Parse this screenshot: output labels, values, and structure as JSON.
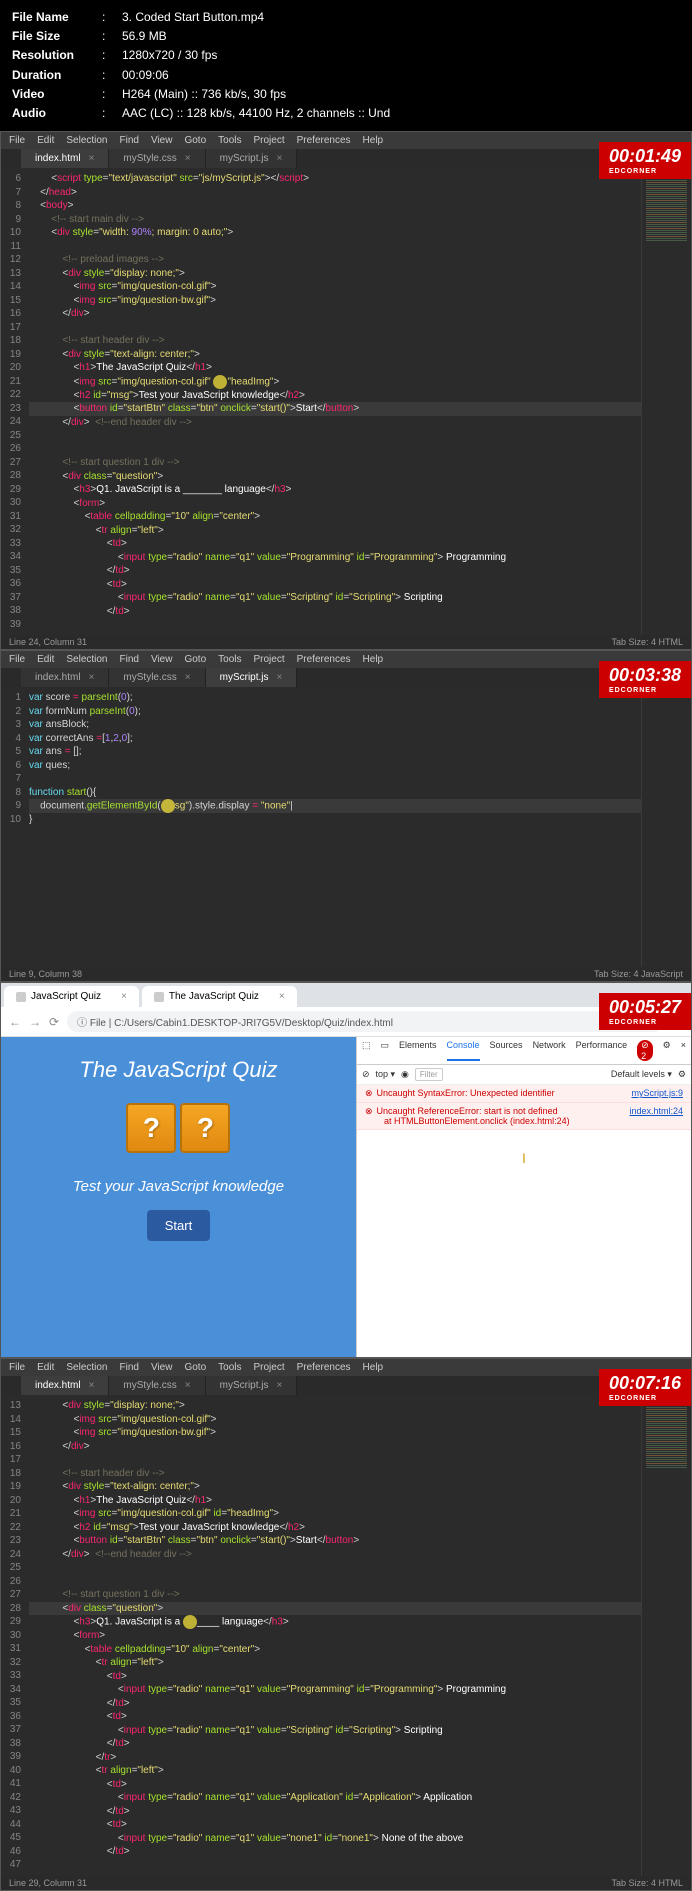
{
  "meta": {
    "fileName": "3. Coded Start Button.mp4",
    "fileSize": "56.9 MB",
    "resolution": "1280x720 / 30 fps",
    "duration": "00:09:06",
    "video": "H264 (Main) :: 736 kb/s, 30 fps",
    "audio": "AAC (LC) :: 128 kb/s, 44100 Hz, 2 channels :: Und"
  },
  "menus": [
    "File",
    "Edit",
    "Selection",
    "Find",
    "View",
    "Goto",
    "Tools",
    "Project",
    "Preferences",
    "Help"
  ],
  "brand": "EDCORNER",
  "panel1": {
    "timestamp": "00:01:49",
    "tabs": [
      {
        "label": "index.html",
        "active": true
      },
      {
        "label": "myStyle.css",
        "active": false
      },
      {
        "label": "myScript.js",
        "active": false
      }
    ],
    "statusLeft": "Line 24, Column 31",
    "statusRight": "Tab Size: 4        HTML"
  },
  "panel2": {
    "timestamp": "00:03:38",
    "tabs": [
      {
        "label": "index.html",
        "active": false
      },
      {
        "label": "myStyle.css",
        "active": false
      },
      {
        "label": "myScript.js",
        "active": true
      }
    ],
    "statusLeft": "Line 9, Column 38",
    "statusRight": "Tab Size: 4        JavaScript"
  },
  "panel3": {
    "timestamp": "00:05:27",
    "browserTabs": [
      {
        "label": "JavaScript Quiz"
      },
      {
        "label": "The JavaScript Quiz"
      }
    ],
    "url": "File | C:/Users/Cabin1.DESKTOP-JRI7G5V/Desktop/Quiz/index.html",
    "quizTitle": "The JavaScript Quiz",
    "quizSubtitle": "Test your JavaScript knowledge",
    "startLabel": "Start",
    "devTabs": [
      "Elements",
      "Console",
      "Sources",
      "Network",
      "Performance"
    ],
    "filterPlaceholder": "Filter",
    "defaultLevels": "Default levels",
    "err1": "Uncaught SyntaxError: Unexpected identifier",
    "err1src": "myScript.js:9",
    "err2": "Uncaught ReferenceError: start is not defined",
    "err2sub": "at HTMLButtonElement.onclick (index.html:24)",
    "err2src": "index.html:24"
  },
  "panel4": {
    "timestamp": "00:07:16",
    "tabs": [
      {
        "label": "index.html",
        "active": true
      },
      {
        "label": "myStyle.css",
        "active": false
      },
      {
        "label": "myScript.js",
        "active": false
      }
    ],
    "statusLeft": "Line 29, Column 31",
    "statusRight": "Tab Size: 4        HTML"
  }
}
